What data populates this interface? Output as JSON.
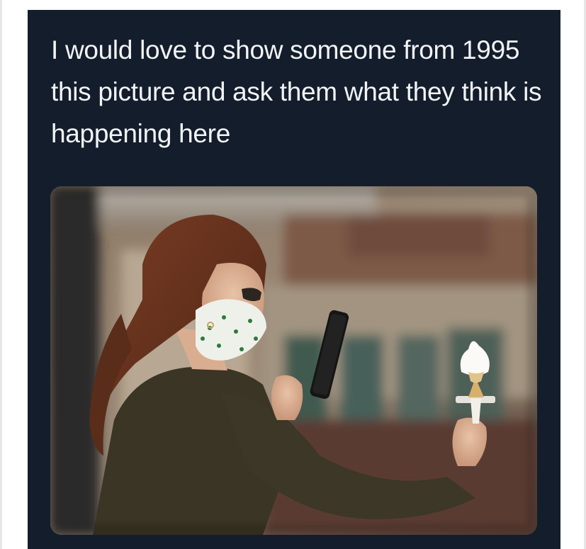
{
  "tweet": {
    "text": "I would love to show someone from 1995 this picture and ask them what they think is happening here"
  },
  "photo": {
    "subject": "woman-in-mask-taking-phone-photo-of-ice-cream-cone"
  },
  "colors": {
    "card_background": "#141d2b",
    "text": "#f2f4f7",
    "page_background": "#ffffff"
  }
}
